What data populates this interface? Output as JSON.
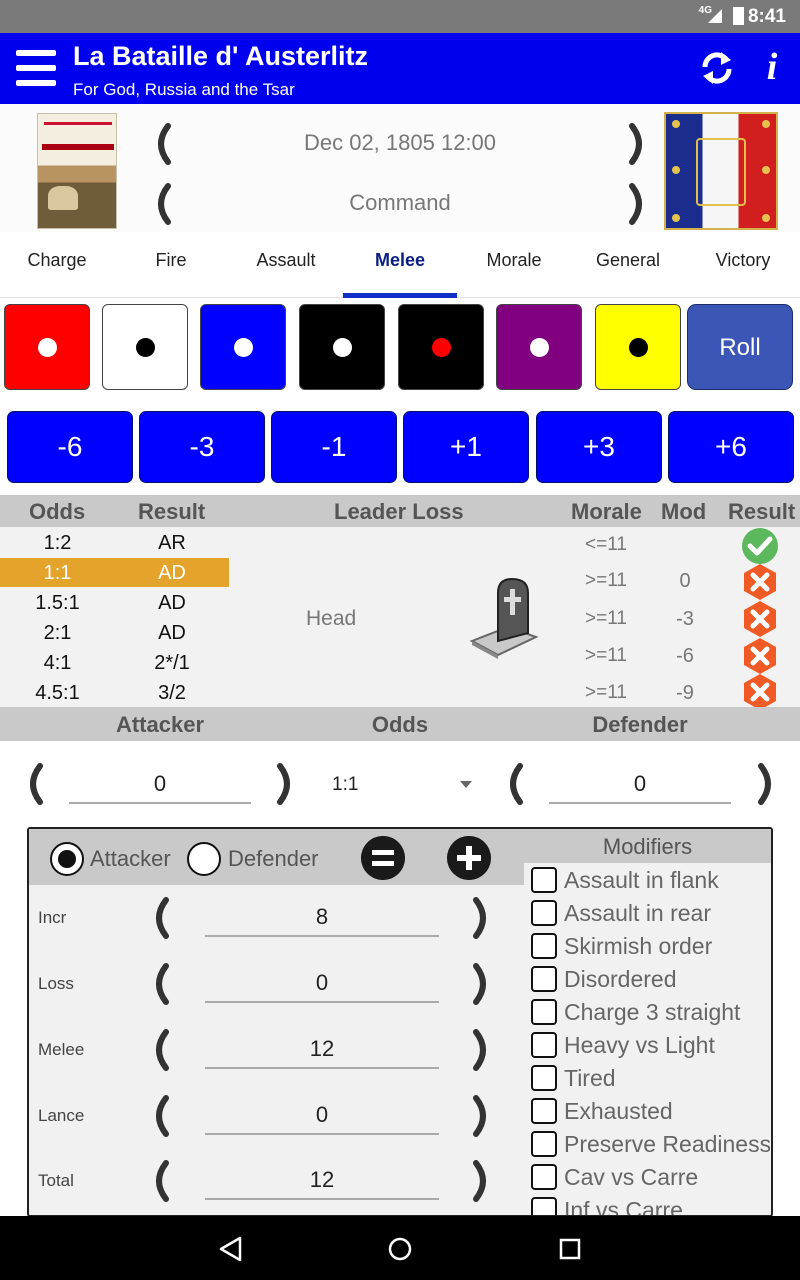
{
  "status_bar": {
    "network": "4G",
    "time": "8:41"
  },
  "app_bar": {
    "title": "La Bataille d' Austerlitz",
    "subtitle": "For God, Russia and the Tsar",
    "icons": [
      "menu-icon",
      "refresh-icon",
      "info-icon"
    ],
    "info_glyph": "i"
  },
  "header": {
    "date": "Dec 02, 1805 12:00",
    "phase": "Command"
  },
  "tabs": [
    {
      "label": "Charge"
    },
    {
      "label": "Fire"
    },
    {
      "label": "Assault"
    },
    {
      "label": "Melee",
      "active": true
    },
    {
      "label": "Morale"
    },
    {
      "label": "General"
    },
    {
      "label": "Victory"
    }
  ],
  "dice": [
    {
      "bg": "#ff0000",
      "pip": "#ffffff"
    },
    {
      "bg": "#ffffff",
      "pip": "#000000"
    },
    {
      "bg": "#0000ff",
      "pip": "#ffffff"
    },
    {
      "bg": "#000000",
      "pip": "#ffffff"
    },
    {
      "bg": "#000000",
      "pip": "#ff0000"
    },
    {
      "bg": "#800080",
      "pip": "#ffffff"
    },
    {
      "bg": "#ffff00",
      "pip": "#000000"
    }
  ],
  "roll_label": "Roll",
  "modifier_buttons": [
    "-6",
    "-3",
    "-1",
    "+1",
    "+3",
    "+6"
  ],
  "results_table": {
    "headers": {
      "odds": "Odds",
      "result": "Result",
      "leader_loss": "Leader Loss",
      "morale": "Morale",
      "mod": "Mod",
      "result2": "Result"
    },
    "rows": [
      {
        "odds": "1:2",
        "result": "AR"
      },
      {
        "odds": "1:1",
        "result": "AD",
        "selected": true
      },
      {
        "odds": "1.5:1",
        "result": "AD"
      },
      {
        "odds": "2:1",
        "result": "AD"
      },
      {
        "odds": "4:1",
        "result": "2*/1"
      },
      {
        "odds": "4.5:1",
        "result": "3/2"
      }
    ],
    "leader_loss": "Head",
    "morale_rows": [
      {
        "morale": "<=11",
        "mod": "",
        "status": "pass"
      },
      {
        "morale": ">=11",
        "mod": "0",
        "status": "fail"
      },
      {
        "morale": ">=11",
        "mod": "-3",
        "status": "fail"
      },
      {
        "morale": ">=11",
        "mod": "-6",
        "status": "fail"
      },
      {
        "morale": ">=11",
        "mod": "-9",
        "status": "fail"
      }
    ]
  },
  "combat": {
    "attacker_label": "Attacker",
    "odds_label": "Odds",
    "defender_label": "Defender",
    "attacker_value": "0",
    "odds_value": "1:1",
    "defender_value": "0"
  },
  "panel": {
    "radio_attacker": "Attacker",
    "radio_defender": "Defender",
    "selected": "Attacker",
    "rows": [
      {
        "label": "Incr",
        "value": "8"
      },
      {
        "label": "Loss",
        "value": "0"
      },
      {
        "label": "Melee",
        "value": "12"
      },
      {
        "label": "Lance",
        "value": "0"
      },
      {
        "label": "Total",
        "value": "12"
      }
    ],
    "modifiers_title": "Modifiers",
    "modifiers": [
      "Assault in flank",
      "Assault in rear",
      "Skirmish order",
      "Disordered",
      "Charge 3 straight",
      "Heavy vs Light",
      "Tired",
      "Exhausted",
      "Preserve Readiness",
      "Cav vs Carre",
      "Inf vs Carre"
    ]
  },
  "nav": {
    "icons": [
      "back-icon",
      "home-icon",
      "recents-icon"
    ]
  }
}
